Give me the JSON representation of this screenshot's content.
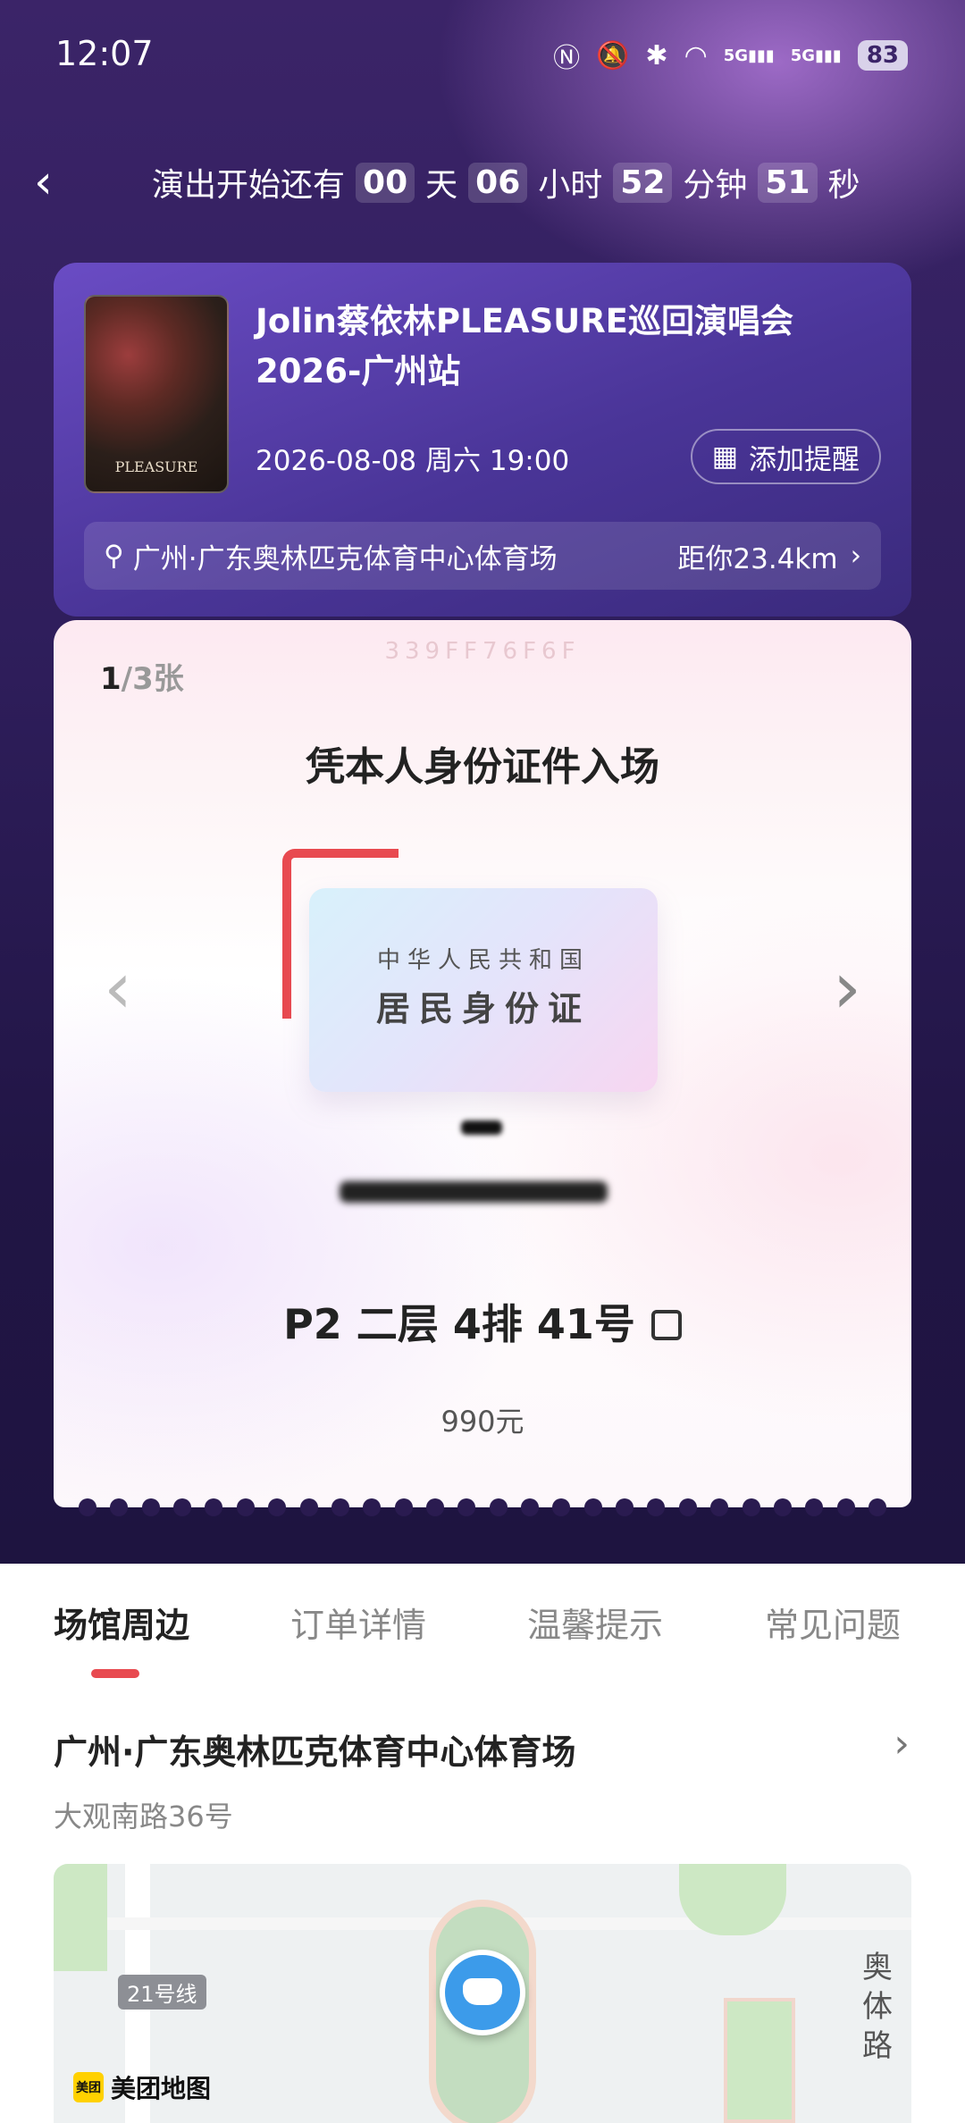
{
  "status_bar": {
    "time": "12:07",
    "battery": "83",
    "network_1": "5G",
    "network_2": "5G"
  },
  "countdown": {
    "prefix": "演出开始还有",
    "days": "00",
    "days_unit": "天",
    "hours": "06",
    "hours_unit": "小时",
    "minutes": "52",
    "minutes_unit": "分钟",
    "seconds": "51",
    "seconds_unit": "秒"
  },
  "event": {
    "poster_text": "PLEASURE",
    "title": "Jolin蔡依林PLEASURE巡回演唱会2026-广州站",
    "datetime": "2026-08-08 周六 19:00",
    "remind_label": "添加提醒",
    "location": "广州·广东奥林匹克体育中心体育场",
    "distance": "距你23.4km"
  },
  "ticket": {
    "current": "1",
    "total": "/3张",
    "code": "339FF76F6F",
    "entry_text": "凭本人身份证件入场",
    "id_card_top": "中华人民共和国",
    "id_card_main": "居民身份证",
    "seat": "P2 二层 4排 41号",
    "price": "990元"
  },
  "tabs": [
    {
      "label": "场馆周边",
      "active": true
    },
    {
      "label": "订单详情",
      "active": false
    },
    {
      "label": "温馨提示",
      "active": false
    },
    {
      "label": "常见问题",
      "active": false
    }
  ],
  "venue": {
    "name": "广州·广东奥林匹克体育中心体育场",
    "address": "大观南路36号"
  },
  "map": {
    "metro_label": "21号线",
    "road_label": "奥体路",
    "provider": "美团地图",
    "provider_logo": "美团"
  },
  "colors": {
    "accent": "#e84a50",
    "header_bg": "#2f1e5c",
    "card_bg": "#4a3598"
  }
}
